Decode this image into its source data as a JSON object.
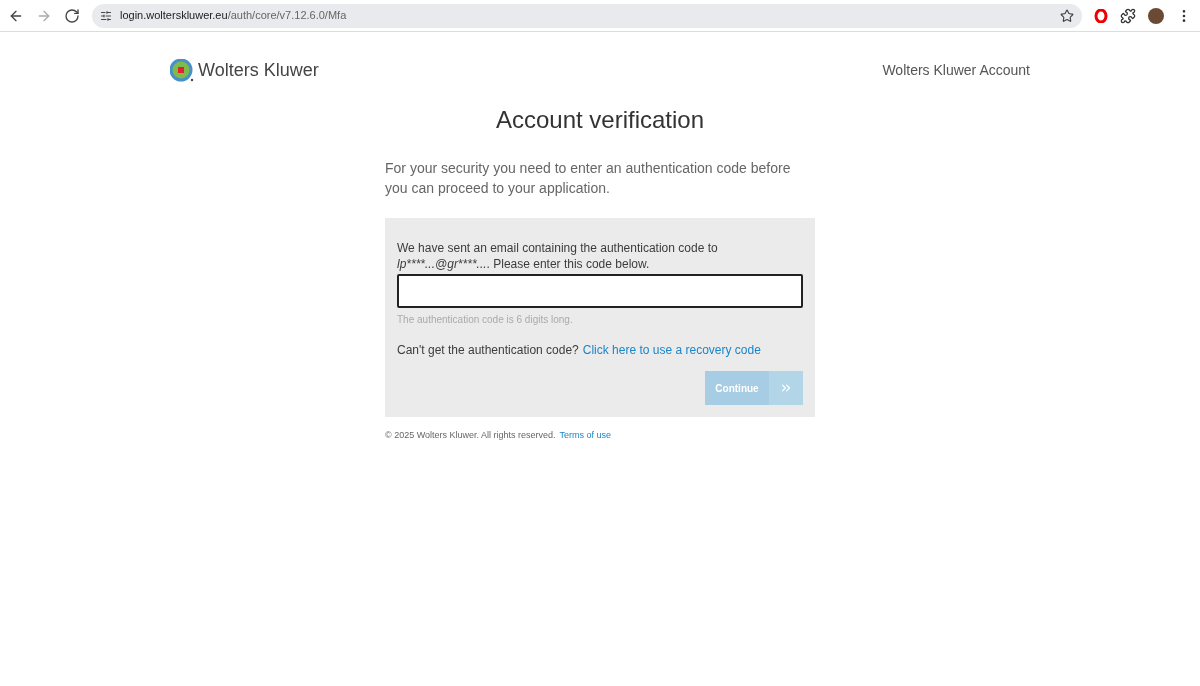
{
  "browser": {
    "url_host": "login.wolterskluwer.eu",
    "url_path": "/auth/core/v7.12.6.0/Mfa"
  },
  "header": {
    "logo_text": "Wolters Kluwer",
    "account_link": "Wolters Kluwer Account"
  },
  "title": "Account verification",
  "intro": "For your security you need to enter an authentication code before you can proceed to your application.",
  "form": {
    "message_start": "We have sent an email containing the authentication code to ",
    "masked_email": "lp****...@gr****...",
    "message_end": ". Please enter this code below.",
    "code_field": {
      "focused": true
    },
    "hint": "The authentication code is 6 digits long.",
    "recovery_prompt": "Can't get the authentication code?",
    "recovery_link": "Click here to use a recovery code",
    "continue_button": {
      "label": "Continue",
      "disabled": true
    }
  },
  "footer": {
    "copyright": "© 2025 Wolters Kluwer. All rights reserved.",
    "terms_link": "Terms of use"
  }
}
